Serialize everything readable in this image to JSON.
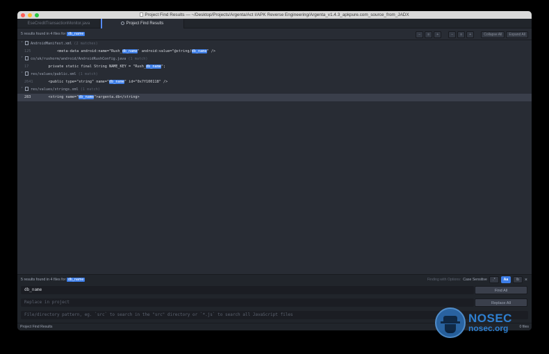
{
  "window": {
    "title": "Project Find Results — ~/Desktop/Projects/Argenta/Act I/APK Reverse Engineering/Argenta_v1.4.3_apkpure.com_source_from_JADX"
  },
  "tabs": [
    {
      "label": "EseCreditTransactionMonitor.java"
    },
    {
      "label": "Project Find Results"
    }
  ],
  "results": {
    "summary_prefix": "5 results found in 4 files for",
    "query": "db_name",
    "toolbar": {
      "collapse_all": "Collapse All",
      "expand_all": "Expand All"
    },
    "files": [
      {
        "path": "AndroidManifest.xml",
        "count": "(2 matches)",
        "matches": [
          {
            "line": "125",
            "pre": "        <meta-data android:name=\"Rush_",
            "hit": "db_name",
            "mid": "\" android:value=\"@string/",
            "hit2": "db_name",
            "post": "\" />"
          }
        ]
      },
      {
        "path": "co/uk/rushorm/android/AndroidRushConfig.java",
        "count": "(1 match)",
        "matches": [
          {
            "line": "17",
            "pre": "    private static final String NAME_KEY = \"Rush_",
            "hit": "db_name",
            "post": "\";"
          }
        ]
      },
      {
        "path": "res/values/public.xml",
        "count": "(1 match)",
        "matches": [
          {
            "line": "2641",
            "pre": "    <public type=\"string\" name=\"",
            "hit": "db_name",
            "post": "\" id=\"0x7f100118\" />"
          }
        ]
      },
      {
        "path": "res/values/strings.xml",
        "count": "(1 match)",
        "matches": [
          {
            "line": "283",
            "pre": "    <string name=\"",
            "hit": "db_name",
            "post": "\">argenta.db</string>"
          }
        ]
      }
    ]
  },
  "find": {
    "summary_prefix": "5 results found in 4 files for",
    "query": "db_name",
    "options_label": "Finding with Options:",
    "options_value": "Case Sensitive",
    "opt_regex": ".*",
    "opt_case": "Aa",
    "opt_word": "\\b",
    "close": "×",
    "find_value": "db_name",
    "replace_placeholder": "Replace in project",
    "path_placeholder": "File/directory pattern, eg. `src` to search in the \"src\" directory or `*.js` to search all JavaScript files",
    "find_all": "Find All",
    "replace_all": "Replace All"
  },
  "statusbar": {
    "left": "Project Find Results",
    "right": "0 files"
  },
  "watermark": {
    "brand": "NOSEC",
    "site": "nosec.org"
  }
}
